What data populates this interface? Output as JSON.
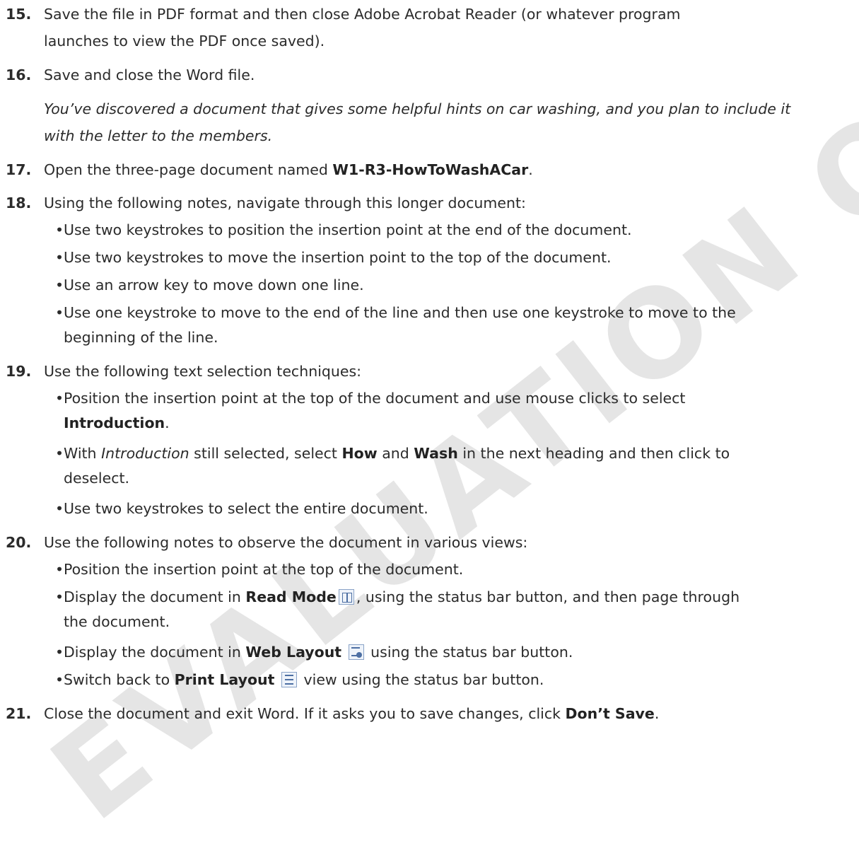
{
  "watermark": "EVALUATION ONLY",
  "steps": {
    "s15": {
      "num": "15.",
      "line1": "Save the file in PDF format and then close Adobe Acrobat Reader (or whatever program",
      "line2": "launches to view the PDF once saved)."
    },
    "s16": {
      "num": "16.",
      "text": "Save and close the Word file."
    },
    "note": {
      "line1": "You’ve discovered a document that gives some helpful hints on car washing, and you plan to include it",
      "line2": "with the letter to the members."
    },
    "s17": {
      "num": "17.",
      "pre": "Open the three-page document named ",
      "bold": "W1-R3-HowToWashACar",
      "post": "."
    },
    "s18": {
      "num": "18.",
      "text": "Using the following notes, navigate through this longer document:",
      "b1": "Use two keystrokes to position the insertion point at the end of the document.",
      "b2": "Use two keystrokes to move the insertion point to the top of the document.",
      "b3": "Use an arrow key to move down one line.",
      "b4_line1": "Use one keystroke to move to the end of the line and then use one keystroke to move to the",
      "b4_line2": "beginning of the line."
    },
    "s19": {
      "num": "19.",
      "text": "Use the following text selection techniques:",
      "b1_line1": "Position the insertion point at the top of the document and use mouse clicks to select",
      "b1_bold": "Introduction",
      "b2_pre": "With ",
      "b2_italic": "Introduction",
      "b2_mid1": " still selected, select ",
      "b2_bold1": "How",
      "b2_mid2": " and ",
      "b2_bold2": "Wash",
      "b2_post": " in the next heading and then click to",
      "b2_line2": "deselect.",
      "b3": "Use two keystrokes to select the entire document."
    },
    "s20": {
      "num": "20.",
      "text": "Use the following notes to observe the document in various views:",
      "b1": "Position the insertion point at the top of the document.",
      "b2_pre": "Display the document in ",
      "b2_bold": "Read Mode",
      "b2_post": ", using the status bar button, and then page through",
      "b2_line2": "the document.",
      "b3_pre": "Display the document in ",
      "b3_bold": "Web Layout",
      "b3_post": " using the status bar button.",
      "b4_pre": "Switch back to ",
      "b4_bold": "Print Layout",
      "b4_post": " view using the status bar button."
    },
    "s21": {
      "num": "21.",
      "pre": "Close the document and exit Word. If it asks you to save changes, click ",
      "bold": "Don’t Save",
      "post": "."
    }
  },
  "bullet_char": "•",
  "icons": [
    "read-mode-icon",
    "web-layout-icon",
    "print-layout-icon"
  ]
}
